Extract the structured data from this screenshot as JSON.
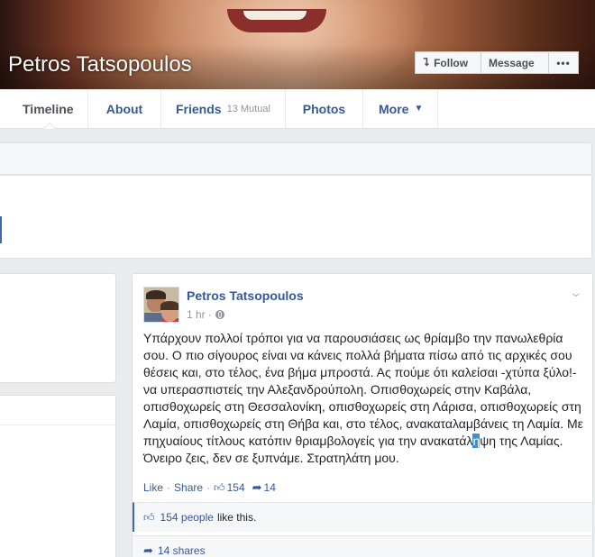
{
  "profile": {
    "name": "Petros Tatsopoulos",
    "actions": {
      "follow": "Follow",
      "message": "Message",
      "more": "•••"
    }
  },
  "nav": {
    "timeline": "Timeline",
    "about": "About",
    "friends": "Friends",
    "friends_mutual": "13 Mutual",
    "photos": "Photos",
    "more": "More"
  },
  "post": {
    "author": "Petros Tatsopoulos",
    "time": "1 hr",
    "text_before": "Υπάρχουν πολλοί τρόποι για να παρουσιάσεις ως θρίαμβο την πανωλεθρία σου. Ο πιο σίγουρος είναι να κάνεις πολλά βήματα πίσω από τις αρχικές σου θέσεις και, στο τέλος, ένα βήμα μπροστά. Ας πούμε ότι καλείσαι -χτύπα ξύλο!- να υπερασπιστείς την Αλεξανδρούπολη. Οπισθοχωρείς στην Καβάλα, οπισθοχωρείς στη Θεσσαλονίκη, οπισθοχωρείς στη Λάρισα, οπισθοχωρείς στη Λαμία, οπισθοχωρείς στη Θήβα και, στο τέλος, ανακαταλαμβάνεις τη Λαμία. Με πηχυαίους τίτλους κατόπιν θριαμβολογείς για την ανακατάλ",
    "text_selected": "η",
    "text_after": "ψη της Λαμίας. Όνειρο ζεις, δεν σε ξυπνάμε. Στρατηλάτη μου.",
    "actions": {
      "like": "Like",
      "share": "Share",
      "likes_count": "154",
      "shares_count": "14"
    },
    "likes_summary": {
      "link": "154 people",
      "rest": "like this."
    },
    "shares_summary": "14 shares"
  },
  "colors": {
    "link": "#365899",
    "accent": "#4267b2",
    "background": "#e9ebee"
  }
}
